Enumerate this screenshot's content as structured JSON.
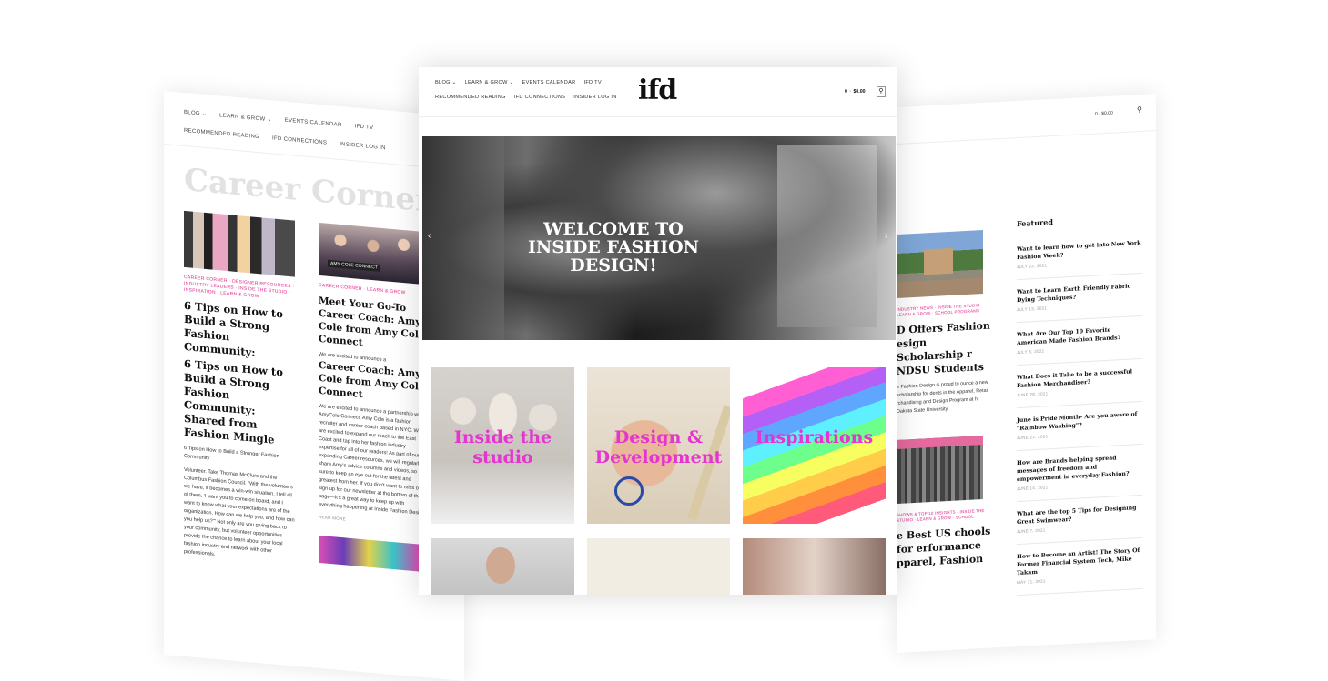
{
  "left_page": {
    "nav_row1": [
      "BLOG ⌄",
      "LEARN & GROW ⌄",
      "EVENTS CALENDAR",
      "IFD TV"
    ],
    "nav_row2": [
      "RECOMMENDED READING",
      "IFD CONNECTIONS",
      "INSIDER LOG IN"
    ],
    "section_title": "Career Corner",
    "post1": {
      "categories": "CAREER CORNER · DESIGNER RESOURCES · INDUSTRY LEADERS · INSIDE THE STUDIO · INSPIRATION · LEARN & GROW",
      "title": "6 Tips on How to Build a Strong Fashion Community:",
      "title_repeat": "6 Tips on How to Build a Strong Fashion Community: Shared from Fashion Mingle",
      "excerpt_title": "6 Tips on How to Build a Stronger Fashion Community",
      "excerpt": "Volunteer. Take Thomas McClure and the Columbus Fashion Council. \"With the volunteers we have, it becomes a win-win situation. I tell all of them, 'I want you to come on board, and I want to know what your expectations are of the organization. How can we help you, and how can you help us?'\" Not only are you giving back to your community, but volunteer opportunities provide the chance to learn about your local fashion industry and network with other professionals."
    },
    "post2": {
      "image_banner": "AMY COLE CONNECT",
      "categories": "CAREER CORNER · LEARN & GROW",
      "title": "Meet Your Go-To Career Coach: Amy Cole from Amy Cole Connect",
      "lead": "We are excited to announce a",
      "title_repeat": "Career Coach: Amy Cole from Amy Cole Connect",
      "excerpt": "We are excited to announce a partnership with AmyCole Connect. Amy Cole is a fashion recruiter and career coach based in NYC. We are excited to expand our reach to the East Coast and tap into her fashion industry expertise for all of our readers! As part of our expanding Career resources, we will regularly share Amy's advice columns and videos, so be sure to keep an eye out for the latest and greatest from her. If you don't want to miss out, sign up for our newsletter at the bottom of the page—it's a great way to keep up with everything happening at Inside Fashion Design.",
      "read_more": "READ MORE"
    }
  },
  "center_page": {
    "nav_row1": [
      "BLOG ⌄",
      "LEARN & GROW ⌄",
      "EVENTS CALENDAR",
      "IFD TV"
    ],
    "nav_row2": [
      "RECOMMENDED READING",
      "IFD CONNECTIONS",
      "INSIDER LOG IN"
    ],
    "logo": "ifd",
    "cart_count": "0",
    "cart_total": "$0.00",
    "search_glyph": "⚲",
    "hero_title": "WELCOME TO INSIDE FASHION DESIGN!",
    "prev_arrow": "‹",
    "next_arrow": "›",
    "tiles": [
      "Inside the studio",
      "Design & Development",
      "Inspirations"
    ]
  },
  "right_page": {
    "cart_text": "0 · $0.00",
    "search_glyph": "⚲",
    "post1": {
      "categories": "INDUSTRY NEWS · INSIDE THE STUDIO · LEARN & GROW · SCHOOL PROGRAMS",
      "title": "D Offers Fashion esign Scholarship r NDSU Students",
      "excerpt": "e Fashion Design is proud to ounce a new scholarship for dents in the Apparel, Retail rchandising and Design Program at h Dakota State University"
    },
    "post2": {
      "image_banner": "",
      "categories": "SHOWS & TOP 10 INSIGHTS · INSIDE THE STUDIO · LEARN & GROW · SCHOOL",
      "title": "e Best US chools for erformance pparel, Fashion"
    },
    "featured_title": "Featured",
    "featured": [
      {
        "title": "Want to learn how to get into New York Fashion Week?",
        "date": "JULY 22, 2021"
      },
      {
        "title": "Want to Learn Earth Friendly Fabric Dying Techniques?",
        "date": "JULY 13, 2021"
      },
      {
        "title": "What Are Our Top 10 Favorite American Made Fashion Brands?",
        "date": "JULY 6, 2021"
      },
      {
        "title": "What Does it Take to be a successful Fashion Merchandiser?",
        "date": "JUNE 28, 2021"
      },
      {
        "title": "June is Pride Month- Are you aware of \"Rainbow Washing\"?",
        "date": "JUNE 21, 2021"
      },
      {
        "title": "How are Brands helping spread messages of freedom and empowerment in everyday Fashion?",
        "date": "JUNE 14, 2021"
      },
      {
        "title": "What are the top 5 Tips for Designing Great Swimwear?",
        "date": "JUNE 7, 2021"
      },
      {
        "title": "How to Become an Artist! The Story Of Former Financial System Tech, Mike Takam",
        "date": "MAY 31, 2021"
      }
    ]
  },
  "colors": {
    "accent_pink": "#e0248b",
    "tile_label_pink": "#e534cf"
  }
}
